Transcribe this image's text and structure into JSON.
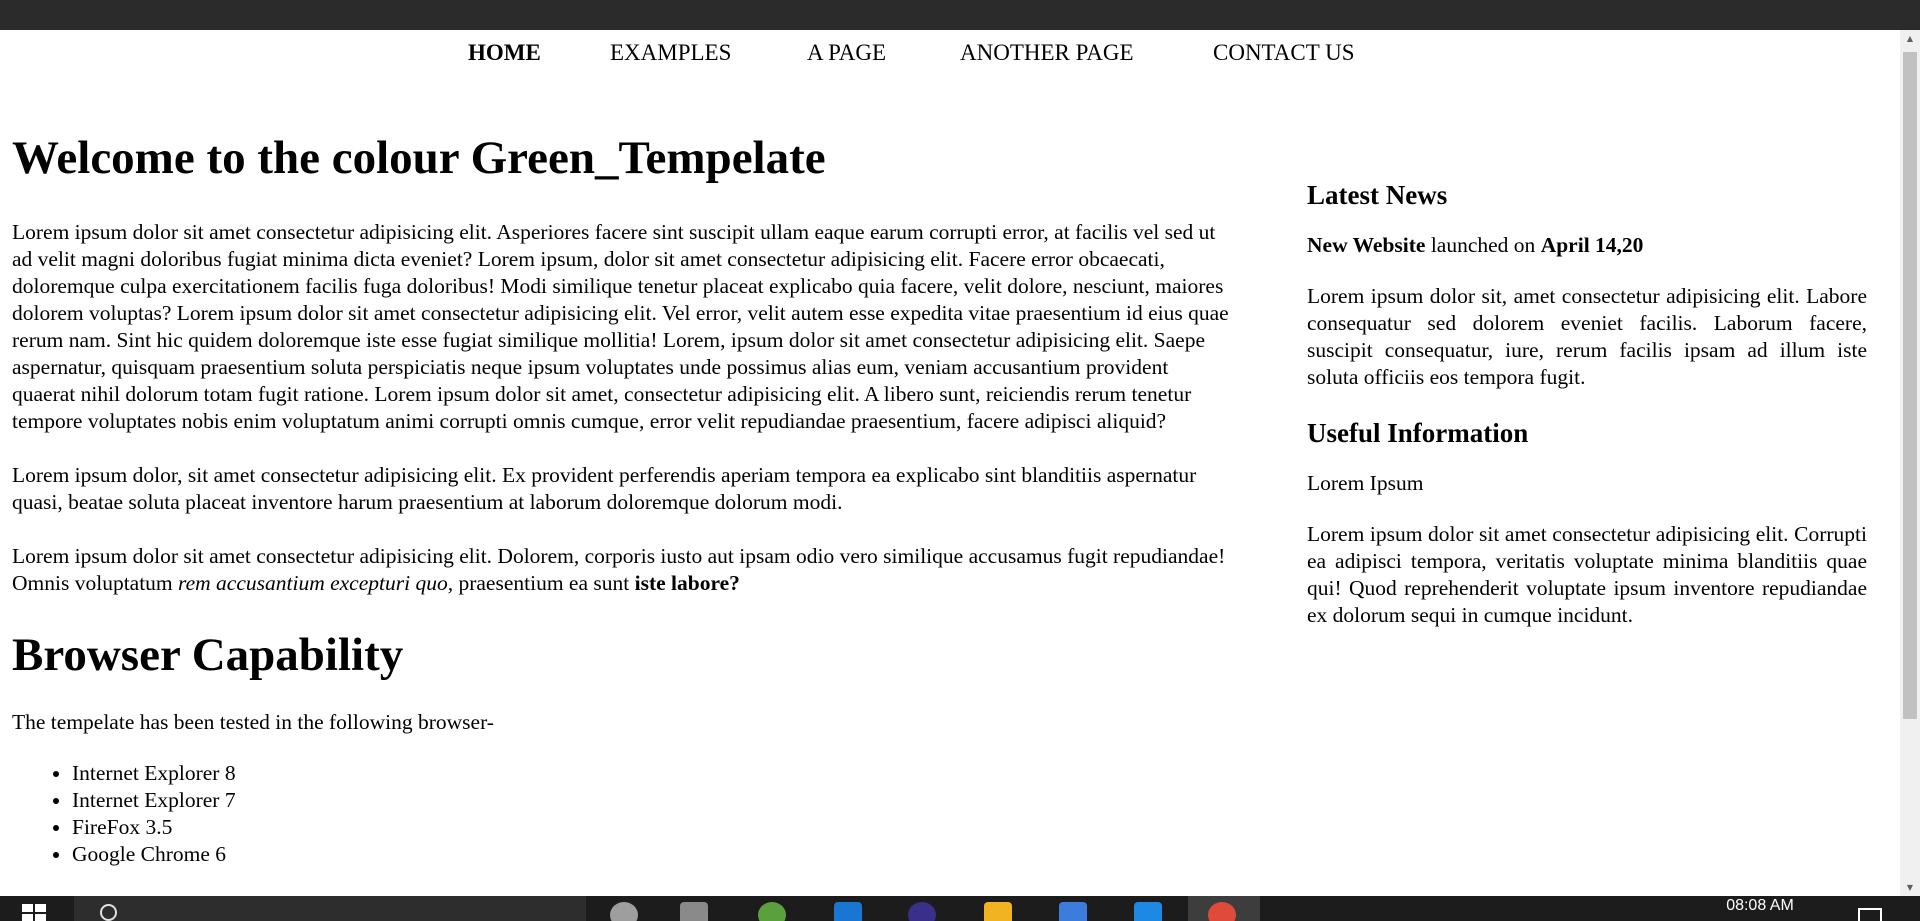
{
  "nav": {
    "items": [
      {
        "label": "HOME",
        "active": true
      },
      {
        "label": "EXAMPLES",
        "active": false
      },
      {
        "label": "A PAGE",
        "active": false
      },
      {
        "label": "ANOTHER PAGE",
        "active": false
      },
      {
        "label": "CONTACT US",
        "active": false
      }
    ]
  },
  "main": {
    "title": "Welcome to the colour Green_Tempelate",
    "paragraph1": "Lorem ipsum dolor sit amet consectetur adipisicing elit. Asperiores facere sint suscipit ullam eaque earum corrupti error, at facilis vel sed ut ad velit magni doloribus fugiat minima dicta eveniet? Lorem ipsum, dolor sit amet consectetur adipisicing elit. Facere error obcaecati, doloremque culpa exercitationem facilis fuga doloribus! Modi similique tenetur placeat explicabo quia facere, velit dolore, nesciunt, maiores dolorem voluptas? Lorem ipsum dolor sit amet consectetur adipisicing elit. Vel error, velit autem esse expedita vitae praesentium id eius quae rerum nam. Sint hic quidem doloremque iste esse fugiat similique mollitia! Lorem, ipsum dolor sit amet consectetur adipisicing elit. Saepe aspernatur, quisquam praesentium soluta perspiciatis neque ipsum voluptates unde possimus alias eum, veniam accusantium provident quaerat nihil dolorum totam fugit ratione. Lorem ipsum dolor sit amet, consectetur adipisicing elit. A libero sunt, reiciendis rerum tenetur tempore voluptates nobis enim voluptatum animi corrupti omnis cumque, error velit repudiandae praesentium, facere adipisci aliquid?",
    "paragraph2": "Lorem ipsum dolor, sit amet consectetur adipisicing elit. Ex provident perferendis aperiam tempora ea explicabo sint blanditiis aspernatur quasi, beatae soluta placeat inventore harum praesentium at laborum doloremque dolorum modi.",
    "paragraph3": {
      "start": "Lorem ipsum dolor sit amet consectetur adipisicing elit. Dolorem, corporis iusto aut ipsam odio vero similique accusamus fugit repudiandae! Omnis voluptatum ",
      "italic": "rem accusantium excepturi quo,",
      "middle": " praesentium ea sunt ",
      "bold": "iste labore?"
    },
    "browser_title": "Browser Capability",
    "browser_intro": "The tempelate has been tested in the following browser-",
    "browsers": [
      "Internet Explorer 8",
      "Internet Explorer 7",
      "FireFox 3.5",
      "Google Chrome 6"
    ]
  },
  "sidebar": {
    "news_title": "Latest News",
    "news_headline": {
      "bold1": "New Website",
      "middle": " launched on ",
      "bold2": "April 14,20"
    },
    "news_text": "Lorem ipsum dolor sit, amet consectetur adipisicing elit. Labore consequatur sed dolorem eveniet facilis. Laborum facere, suscipit consequatur, iure, rerum facilis ipsam ad illum iste soluta officiis eos tempora fugit.",
    "info_title": "Useful Information",
    "info_subtitle": "Lorem Ipsum",
    "info_text": "Lorem ipsum dolor sit amet consectetur adipisicing elit. Corrupti ea adipisci tempora, veritatis voluptate minima blanditiis quae qui! Quod reprehenderit voluptate ipsum inventore repudiandae ex dolorum sequi in cumque incidunt."
  },
  "taskbar": {
    "clock": "08:08 AM",
    "icons": [
      {
        "name": "task-view-icon",
        "color": "#9e9e9e"
      },
      {
        "name": "explorer-pinned-icon",
        "color": "#8a8a8a"
      },
      {
        "name": "green-app-icon",
        "color": "#5aa03c"
      },
      {
        "name": "mail-icon",
        "color": "#1976d2"
      },
      {
        "name": "firefox-icon",
        "color": "#3a2f8a"
      },
      {
        "name": "file-explorer-icon",
        "color": "#f2b322"
      },
      {
        "name": "store-icon",
        "color": "#3b7ddd"
      },
      {
        "name": "vscode-icon",
        "color": "#1e88e5"
      },
      {
        "name": "chrome-icon",
        "color": "#e04a3a"
      }
    ]
  }
}
